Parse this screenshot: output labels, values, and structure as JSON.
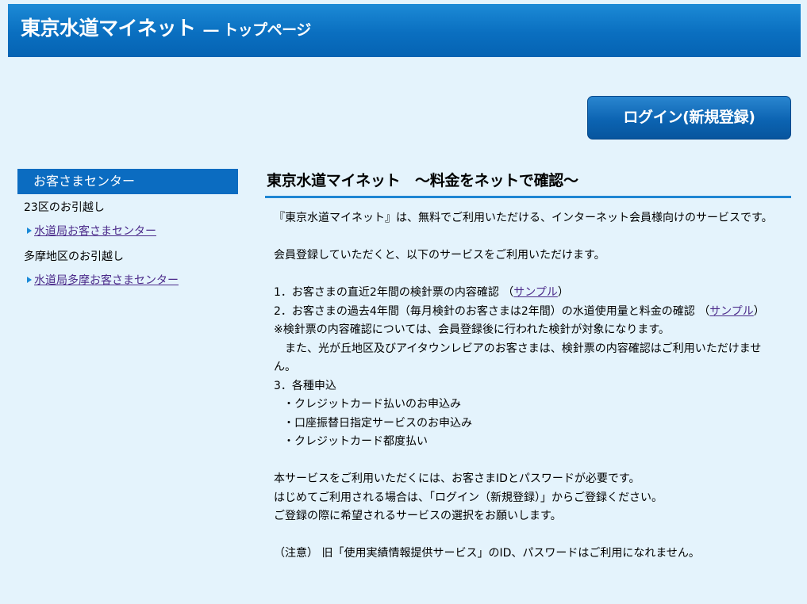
{
  "header": {
    "title": "東京水道マイネット",
    "subtitle": "― トップページ"
  },
  "login_button": {
    "label": "ログイン(新規登録)"
  },
  "sidebar": {
    "heading": "お客さまセンター",
    "sections": [
      {
        "label": "23区のお引越し",
        "link": "水道局お客さまセンター"
      },
      {
        "label": "多摩地区のお引越し",
        "link": "水道局多摩お客さまセンター"
      }
    ]
  },
  "content": {
    "title": "東京水道マイネット　～料金をネットで確認～",
    "intro": "『東京水道マイネット』は、無料でご利用いただける、インターネット会員様向けのサービスです。",
    "services_intro": "会員登録していただくと、以下のサービスをご利用いただけます。",
    "item1_text": "1．お客さまの直近2年間の検針票の内容確認",
    "item1_open": "（",
    "item1_link": "サンプル",
    "item1_close": "）",
    "item2_text": "2．お客さまの過去4年間（毎月検針のお客さまは2年間）の水道使用量と料金の確認",
    "item2_open": "（",
    "item2_link": "サンプル",
    "item2_close": "）",
    "note1": "※検針票の内容確認については、会員登録後に行われた検針が対象になります。",
    "note2": "　また、光が丘地区及びアイタウンレビアのお客さまは、検針票の内容確認はご利用いただけません。",
    "item3_text": "3．各種申込",
    "bullets": [
      "・クレジットカード払いのお申込み",
      "・口座振替日指定サービスのお申込み",
      "・クレジットカード都度払い"
    ],
    "closing1": "本サービスをご利用いただくには、お客さまIDとパスワードが必要です。",
    "closing2": "はじめてご利用される場合は、「ログイン（新規登録）」からご登録ください。",
    "closing3": "ご登録の際に希望されるサービスの選択をお願いします。",
    "caution": "（注意）  旧「使用実績情報提供サービス」のID、パスワードはご利用になれません。"
  }
}
